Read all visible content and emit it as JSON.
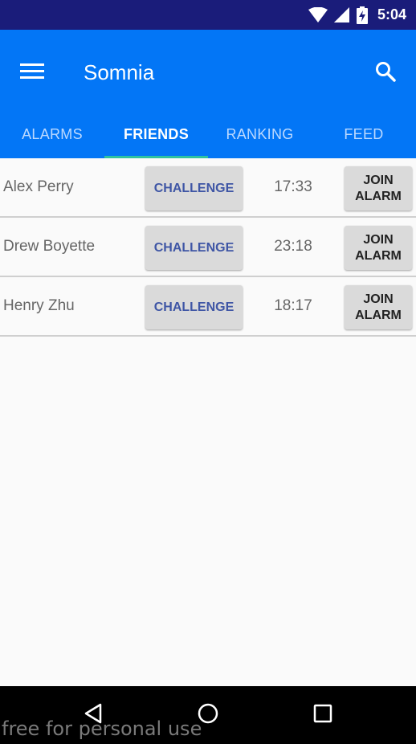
{
  "status_bar": {
    "time": "5:04",
    "icons": [
      "wifi-icon",
      "signal-icon",
      "battery-charging-icon"
    ]
  },
  "app_bar": {
    "title": "Somnia",
    "menu_icon": "menu-icon",
    "search_icon": "search-icon"
  },
  "tabs": [
    {
      "label": "ALARMS",
      "active": false
    },
    {
      "label": "FRIENDS",
      "active": true
    },
    {
      "label": "RANKING",
      "active": false
    },
    {
      "label": "FEED",
      "active": false
    }
  ],
  "friends": [
    {
      "name": "Alex Perry",
      "challenge_label": "CHALLENGE",
      "time": "17:33",
      "join_label": "JOIN\nALARM"
    },
    {
      "name": "Drew Boyette",
      "challenge_label": "CHALLENGE",
      "time": "23:18",
      "join_label": "JOIN\nALARM"
    },
    {
      "name": "Henry Zhu",
      "challenge_label": "CHALLENGE",
      "time": "18:17",
      "join_label": "JOIN\nALARM"
    }
  ],
  "nav_bar": {
    "icons": [
      "back-icon",
      "home-icon",
      "recents-icon"
    ]
  },
  "watermark": "free for personal use",
  "colors": {
    "app_bar": "#0376f6",
    "status_bar": "#1a1c7a",
    "tab_indicator": "#2fc2a0",
    "challenge_text": "#3f56a5"
  }
}
